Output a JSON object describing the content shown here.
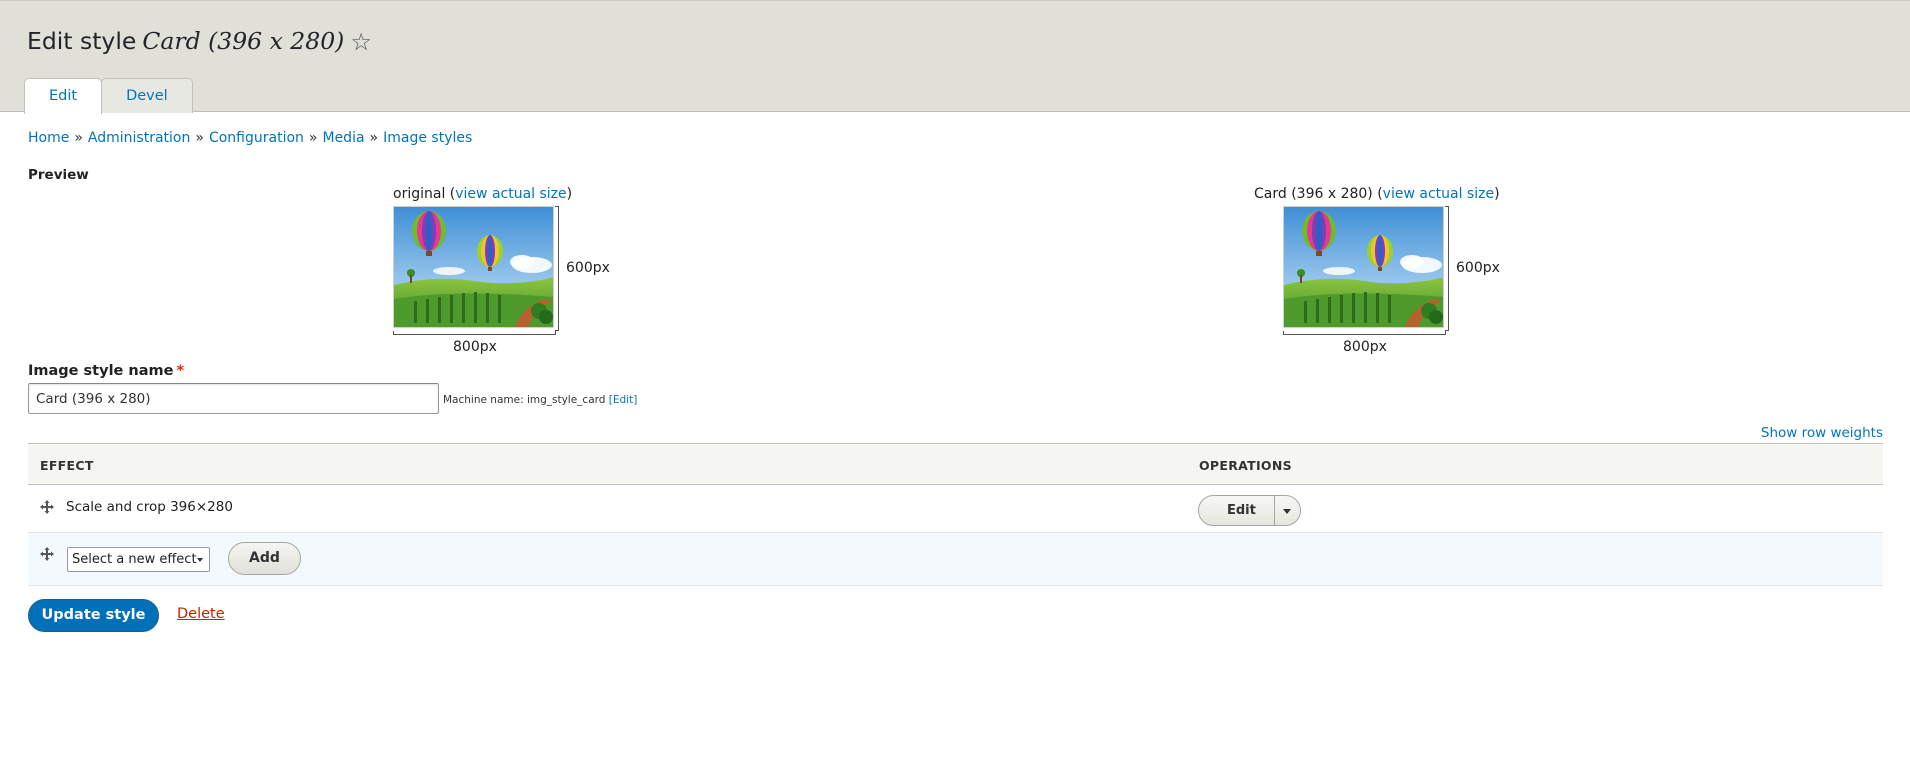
{
  "header": {
    "title_prefix": "Edit style",
    "title_name": "Card (396 x 280)",
    "star_icon": "☆"
  },
  "tabs": [
    {
      "label": "Edit",
      "active": true
    },
    {
      "label": "Devel",
      "active": false
    }
  ],
  "breadcrumb": {
    "separator": "»",
    "items": [
      "Home",
      "Administration",
      "Configuration",
      "Media",
      "Image styles"
    ]
  },
  "preview": {
    "heading": "Preview",
    "original": {
      "caption_prefix": "original (",
      "link": "view actual size",
      "caption_suffix": ")",
      "width_label": "800px",
      "height_label": "600px"
    },
    "derivative": {
      "caption_prefix": "Card (396 x 280) (",
      "link": "view actual size",
      "caption_suffix": ")",
      "width_label": "800px",
      "height_label": "600px"
    }
  },
  "form": {
    "name_label": "Image style name",
    "required_mark": "*",
    "name_value": "Card (396 x 280)",
    "machine_name_prefix": "Machine name: img_style_card",
    "machine_name_edit": "[Edit]"
  },
  "table": {
    "show_weights": "Show row weights",
    "col_effect": "EFFECT",
    "col_operations": "OPERATIONS",
    "rows": [
      {
        "effect": "Scale and crop 396×280",
        "edit_label": "Edit"
      }
    ],
    "new_effect_select": "Select a new effect",
    "add_label": "Add"
  },
  "actions": {
    "update_label": "Update style",
    "delete_label": "Delete"
  },
  "colors": {
    "link": "#0074bd",
    "primary_button": "#0071b8",
    "danger": "#c72100",
    "header_bg": "#e0e0d8"
  }
}
